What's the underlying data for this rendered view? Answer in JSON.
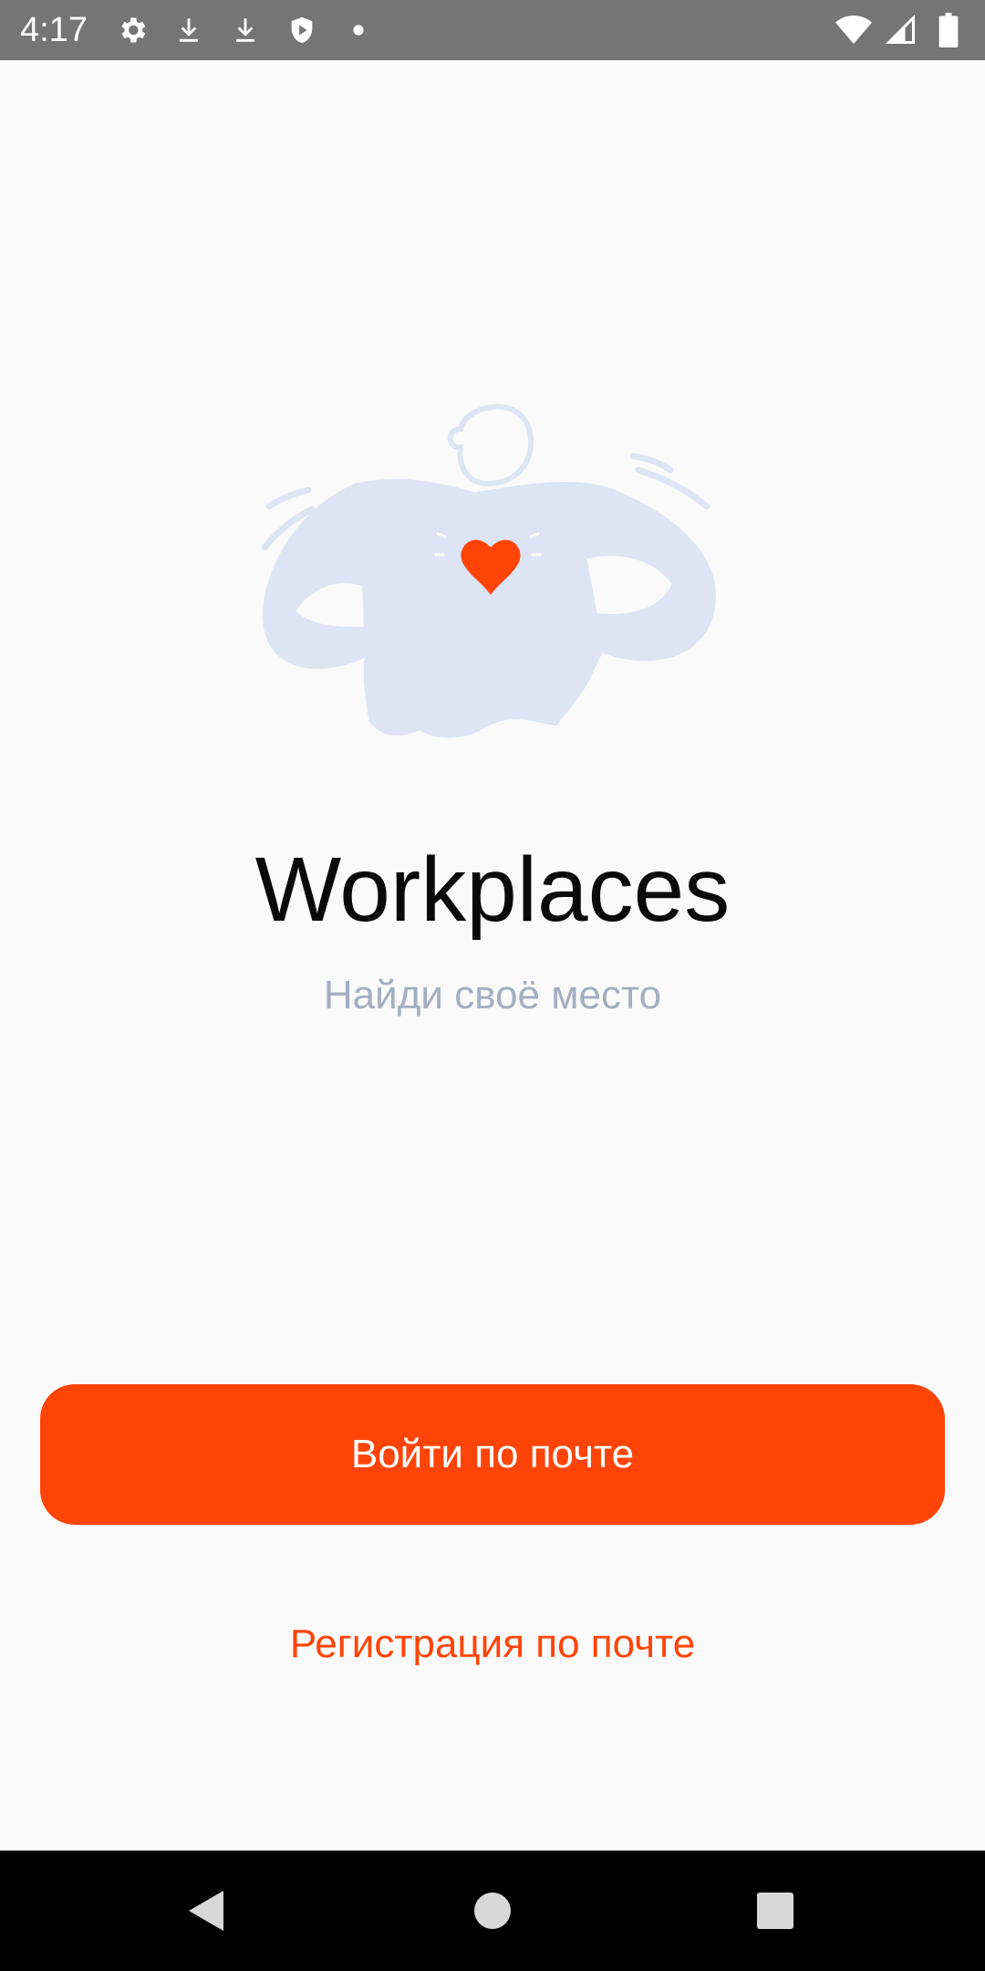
{
  "status_bar": {
    "time": "4:17",
    "left_icons": [
      "settings-icon",
      "download-icon",
      "download-icon",
      "shield-play-icon",
      "dot-icon"
    ],
    "right_icons": [
      "wifi-icon",
      "cell-signal-icon",
      "battery-icon"
    ]
  },
  "app": {
    "title": "Workplaces",
    "subtitle": "Найди своё место"
  },
  "actions": {
    "login_label": "Войти по почте",
    "register_label": "Регистрация по почте"
  },
  "colors": {
    "accent": "#ff4408",
    "subtitle": "#a3aec2",
    "illustration": "#dde4f4",
    "status_bar": "#757575",
    "nav_bar": "#000000"
  },
  "nav_bar": {
    "buttons": [
      "back-icon",
      "home-icon",
      "recents-icon"
    ]
  }
}
